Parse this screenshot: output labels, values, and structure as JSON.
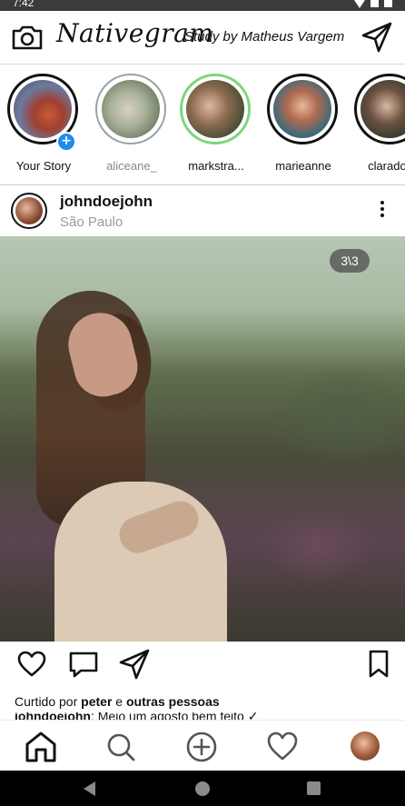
{
  "status_bar": {
    "time": "7:42"
  },
  "header": {
    "brand": "Nativegram",
    "subtitle": "Study by Matheus Vargem",
    "camera_icon": "camera-icon",
    "send_icon": "send-icon"
  },
  "stories": [
    {
      "label": "Your Story",
      "seen": false,
      "own": true,
      "ring": "#111111"
    },
    {
      "label": "aliceane_",
      "seen": true,
      "own": false,
      "ring": "#9aa0a6"
    },
    {
      "label": "markstra...",
      "seen": false,
      "own": false,
      "ring": "#7dd67a"
    },
    {
      "label": "marieanne",
      "seen": false,
      "own": false,
      "ring": "#111111"
    },
    {
      "label": "claradoe",
      "seen": false,
      "own": false,
      "ring": "#111111"
    }
  ],
  "post": {
    "username": "johndoejohn",
    "location": "São Paulo",
    "counter": "3\\3",
    "liked_by_prefix": "Curtido por",
    "liked_by_user": "peter",
    "liked_by_joiner": "e",
    "liked_by_others": "outras pessoas",
    "caption_user": "johndoejohn",
    "caption_text": ": Meio um agosto bem feito ✓"
  },
  "colors": {
    "accent_blue": "#1d8cf0",
    "seen_ring": "#9aa0a6",
    "close_friends_ring": "#7dd67a",
    "text_muted": "#9a9aa0"
  },
  "bottom_nav": [
    "home-icon",
    "search-icon",
    "add-post-icon",
    "heart-icon",
    "profile-avatar"
  ]
}
